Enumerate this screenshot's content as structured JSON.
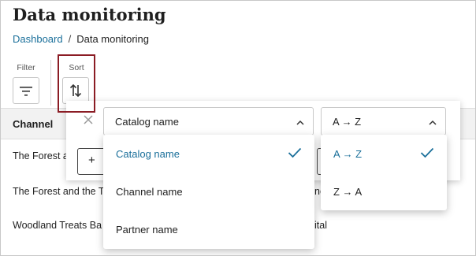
{
  "page": {
    "title": "Data monitoring"
  },
  "breadcrumb": {
    "parent": "Dashboard",
    "separator": "/",
    "current": "Data monitoring"
  },
  "toolbar": {
    "filter_label": "Filter",
    "sort_label": "Sort",
    "filter_icon": "filter-icon",
    "sort_icon": "sort-icon"
  },
  "table": {
    "columns": [
      "Channel"
    ],
    "rows": [
      {
        "channel": "The Forest a",
        "extra": ""
      },
      {
        "channel": "The Forest and the T",
        "extra": "nc"
      },
      {
        "channel": "Woodland Treats Ba",
        "extra": "ital"
      }
    ]
  },
  "sort_panel": {
    "close_icon": "close-icon",
    "field_select_value": "Catalog name",
    "order_select_value": "A → Z",
    "add_button_label": "+",
    "field_options": [
      {
        "label": "Catalog name",
        "selected": true
      },
      {
        "label": "Channel name",
        "selected": false
      },
      {
        "label": "Partner name",
        "selected": false
      }
    ],
    "order_options": [
      {
        "label": "A → Z",
        "selected": true
      },
      {
        "label": "Z → A",
        "selected": false
      }
    ]
  },
  "colors": {
    "link": "#1a6f9a",
    "highlight_border": "#8b1c24",
    "header_bg": "#f2f2f2"
  }
}
